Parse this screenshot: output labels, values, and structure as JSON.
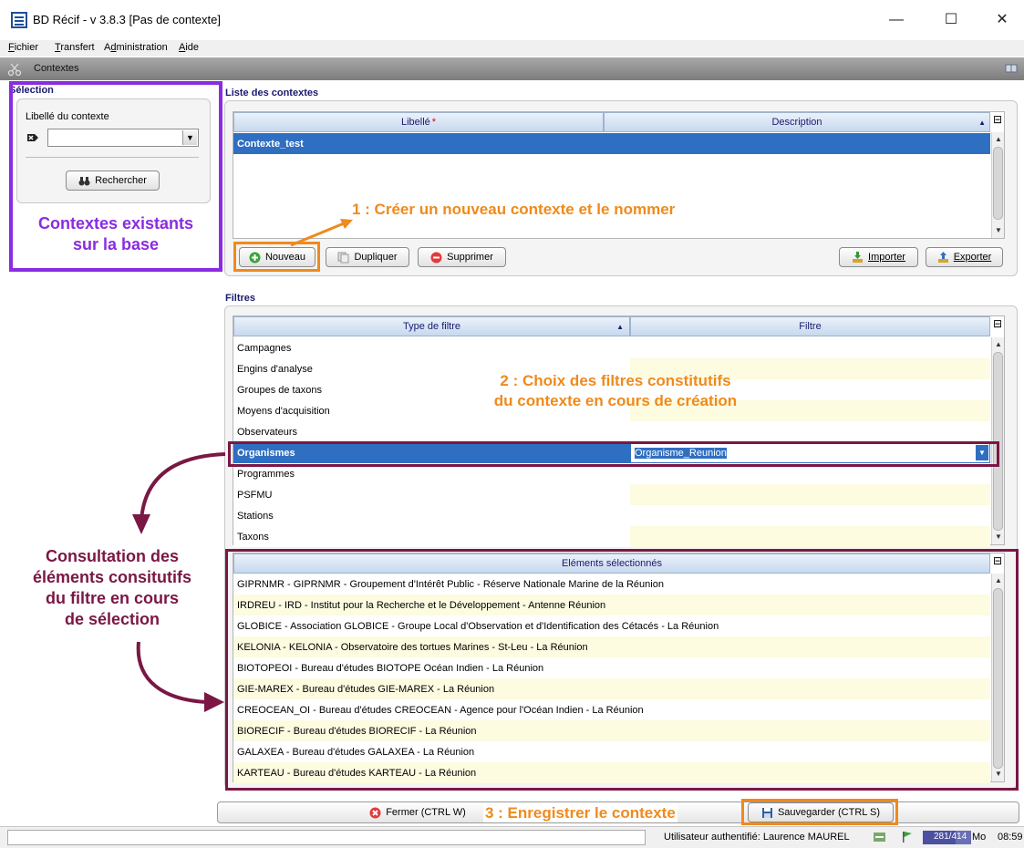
{
  "window": {
    "title": "BD Récif - v 3.8.3 [Pas de contexte]",
    "controls": [
      "—",
      "☐",
      "✕"
    ]
  },
  "menu": [
    {
      "pre": "",
      "u": "F",
      "post": "ichier"
    },
    {
      "pre": "",
      "u": "T",
      "post": "ransfert"
    },
    {
      "pre": "A",
      "u": "d",
      "post": "ministration"
    },
    {
      "pre": "",
      "u": "A",
      "post": "ide"
    }
  ],
  "module": {
    "title": "Contextes"
  },
  "selection": {
    "title": "Sélection",
    "field_label": "Libellé du contexte",
    "field_value": "",
    "search_button": "Rechercher"
  },
  "contexts": {
    "title": "Liste des contextes",
    "columns": [
      "Libellé",
      "Description"
    ],
    "required_mark": "*",
    "rows": [
      {
        "label": "Contexte_test",
        "description": ""
      }
    ],
    "buttons": {
      "new": "Nouveau",
      "duplicate": "Dupliquer",
      "delete": "Supprimer",
      "import": "Importer",
      "export": "Exporter"
    }
  },
  "filters": {
    "title": "Filtres",
    "columns": [
      "Type de filtre",
      "Filtre"
    ],
    "rows": [
      {
        "type": "Campagnes",
        "filter": ""
      },
      {
        "type": "Engins d'analyse",
        "filter": ""
      },
      {
        "type": "Groupes de taxons",
        "filter": ""
      },
      {
        "type": "Moyens d'acquisition",
        "filter": ""
      },
      {
        "type": "Observateurs",
        "filter": ""
      },
      {
        "type": "Organismes",
        "filter": "Organisme_Reunion"
      },
      {
        "type": "Programmes",
        "filter": ""
      },
      {
        "type": "PSFMU",
        "filter": ""
      },
      {
        "type": "Stations",
        "filter": ""
      },
      {
        "type": "Taxons",
        "filter": ""
      }
    ],
    "selected_index": 5
  },
  "selected_elements": {
    "title": "Eléments sélectionnés",
    "rows": [
      "GIPRNMR - GIPRNMR - Groupement d'Intérêt Public - Réserve Nationale Marine de la Réunion",
      "IRDREU - IRD - Institut pour la Recherche et le Développement - Antenne Réunion",
      "GLOBICE - Association GLOBICE - Groupe Local d'Observation et d'Identification des Cétacés - La Réunion",
      "KELONIA - KELONIA - Observatoire des tortues Marines - St-Leu - La Réunion",
      "BIOTOPEOI - Bureau d'études BIOTOPE Océan Indien - La Réunion",
      "GIE-MAREX - Bureau d'études GIE-MAREX - La Réunion",
      "CREOCEAN_OI - Bureau d'études CREOCEAN - Agence pour l'Océan Indien - La Réunion",
      "BIORECIF - Bureau d'études BIORECIF - La Réunion",
      "GALAXEA - Bureau d'études GALAXEA - La Réunion",
      "KARTEAU - Bureau d'études KARTEAU - La Réunion"
    ]
  },
  "footer": {
    "close": "Fermer (CTRL W)",
    "save": "Sauvegarder (CTRL S)"
  },
  "status": {
    "user": "Utilisateur authentifié: Laurence MAUREL",
    "memory": "281/414",
    "memory_unit": "Mo",
    "time": "08:59"
  },
  "annotations": {
    "existing": [
      "Contextes existants",
      "sur la base"
    ],
    "step1": "1 : Créer un nouveau contexte et le nommer",
    "step2": [
      "2 : Choix des filtres constitutifs",
      "du contexte en cours de création"
    ],
    "consultation": [
      "Consultation des",
      "éléments consitutifs",
      "du filtre en cours",
      "de sélection"
    ],
    "step3": "3 : Enregistrer le contexte"
  },
  "colors": {
    "purple_box": "#8b2be2",
    "orange": "#ef8a1c",
    "maroon": "#7a1745",
    "selection_blue": "#2f6fc2",
    "alt_row": "#fdfbe0"
  },
  "icons": [
    "app-icon",
    "binoculars-icon",
    "add-icon",
    "duplicate-icon",
    "delete-icon",
    "import-icon",
    "export-icon",
    "close-icon",
    "save-icon",
    "edit-icon",
    "gc-icon",
    "flag-icon"
  ]
}
